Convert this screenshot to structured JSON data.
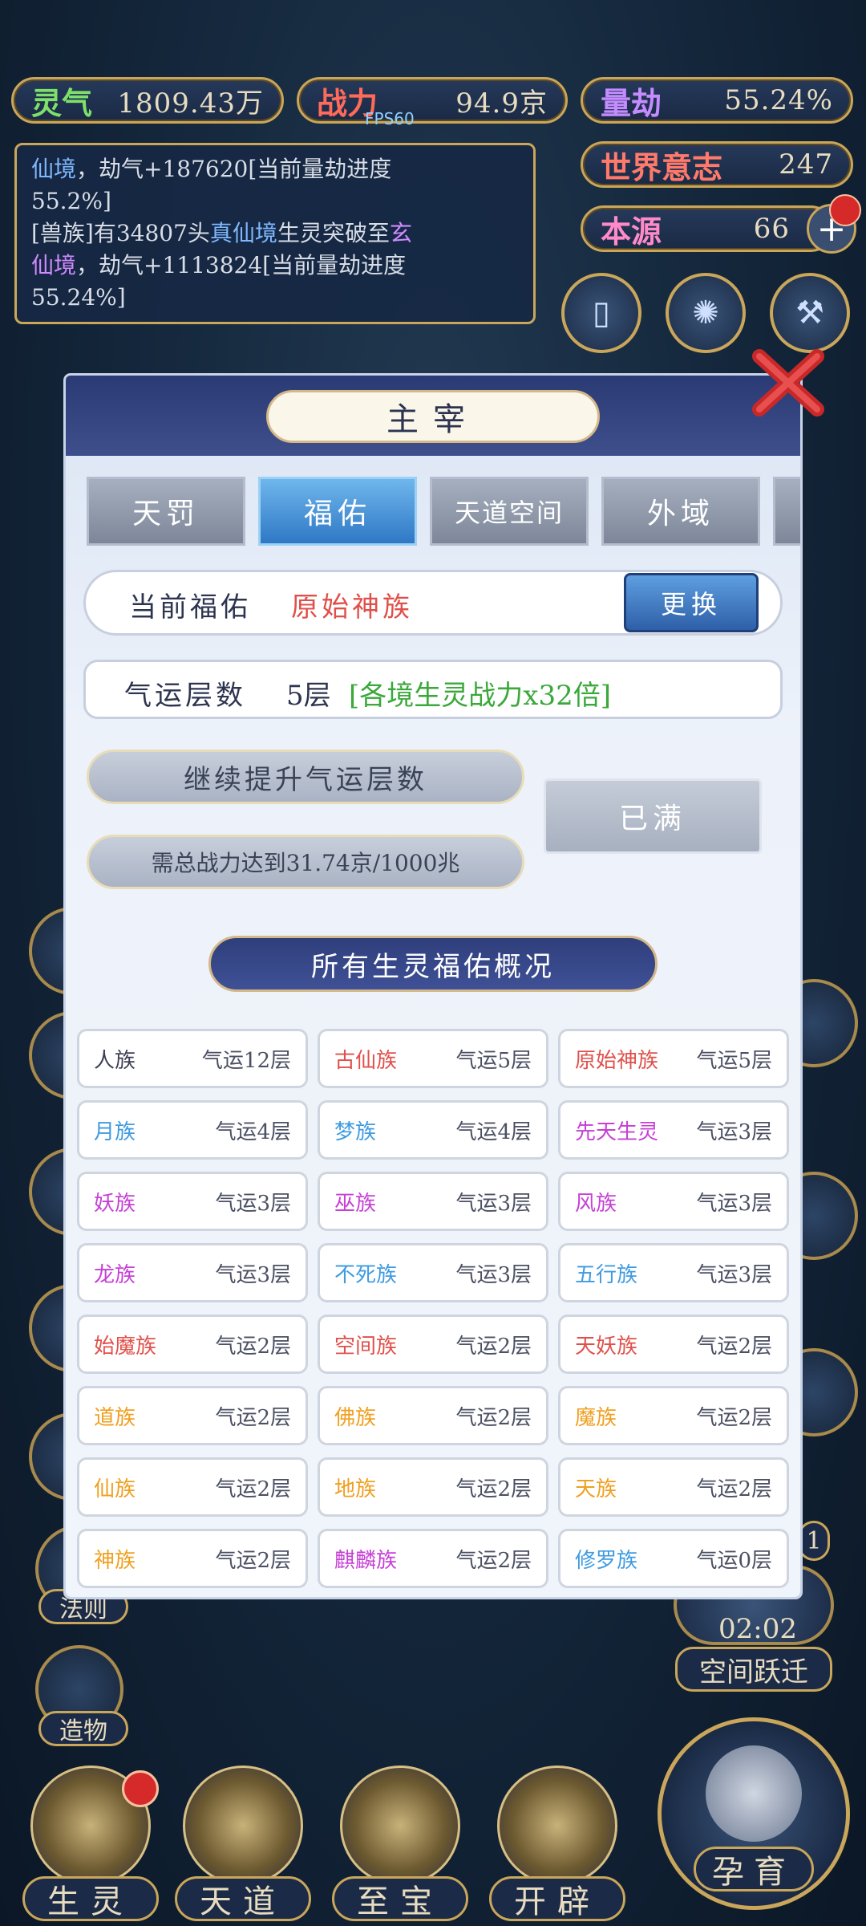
{
  "topbar": {
    "lingqi": {
      "label": "灵气",
      "value": "1809.43万"
    },
    "zhanli": {
      "label": "战力",
      "value": "94.9京"
    },
    "liangjie": {
      "label": "量劫",
      "value": "55.24%"
    },
    "world_will": {
      "label": "世界意志",
      "value": "247"
    },
    "benyuan": {
      "label": "本源",
      "value": "66"
    },
    "fps": "FPS60"
  },
  "log": {
    "line1a": "仙境",
    "line1b": "，劫气+187620[当前量劫进度",
    "line2": "55.2%]",
    "line3a": "[兽族]有34807头",
    "line3b": "真仙境",
    "line3c": "生灵突破至",
    "line3d": "玄",
    "line4a": "仙境",
    "line4b": "，劫气+1113824[当前量劫进度",
    "line5": "55.24%]"
  },
  "side_left": [
    {
      "label": "法则"
    },
    {
      "label": "造物"
    }
  ],
  "side_right": {
    "timer": "02:02",
    "label": "空间跃迁",
    "count": "1"
  },
  "bottom_nav": [
    {
      "label": "生灵"
    },
    {
      "label": "天道"
    },
    {
      "label": "至宝"
    },
    {
      "label": "开辟"
    },
    {
      "label": "孕育"
    }
  ],
  "modal": {
    "title": "主宰",
    "tabs": [
      "天罚",
      "福佑",
      "天道空间",
      "外域"
    ],
    "active_tab": "福佑",
    "current_label": "当前福佑",
    "current_value": "原始神族",
    "change_btn": "更换",
    "fortune_label": "气运层数",
    "fortune_value": "5层",
    "fortune_bonus": "[各境生灵战力x32倍]",
    "upgrade_title": "继续提升气运层数",
    "upgrade_req": "需总战力达到31.74京/1000兆",
    "full_btn": "已满",
    "overview_title": "所有生灵福佑概况",
    "races": [
      {
        "name": "人族",
        "level": "气运12层",
        "color": "#3b3f52"
      },
      {
        "name": "古仙族",
        "level": "气运5层",
        "color": "#e0504a"
      },
      {
        "name": "原始神族",
        "level": "气运5层",
        "color": "#e0504a"
      },
      {
        "name": "月族",
        "level": "气运4层",
        "color": "#3f9be0"
      },
      {
        "name": "梦族",
        "level": "气运4层",
        "color": "#3f9be0"
      },
      {
        "name": "先天生灵",
        "level": "气运3层",
        "color": "#c640d6"
      },
      {
        "name": "妖族",
        "level": "气运3层",
        "color": "#c640d6"
      },
      {
        "name": "巫族",
        "level": "气运3层",
        "color": "#c640d6"
      },
      {
        "name": "风族",
        "level": "气运3层",
        "color": "#c640d6"
      },
      {
        "name": "龙族",
        "level": "气运3层",
        "color": "#c640d6"
      },
      {
        "name": "不死族",
        "level": "气运3层",
        "color": "#3f9be0"
      },
      {
        "name": "五行族",
        "level": "气运3层",
        "color": "#3f9be0"
      },
      {
        "name": "始魔族",
        "level": "气运2层",
        "color": "#e0504a"
      },
      {
        "name": "空间族",
        "level": "气运2层",
        "color": "#e0504a"
      },
      {
        "name": "天妖族",
        "level": "气运2层",
        "color": "#e0504a"
      },
      {
        "name": "道族",
        "level": "气运2层",
        "color": "#f0a020"
      },
      {
        "name": "佛族",
        "level": "气运2层",
        "color": "#f0a020"
      },
      {
        "name": "魔族",
        "level": "气运2层",
        "color": "#f0a020"
      },
      {
        "name": "仙族",
        "level": "气运2层",
        "color": "#f0a020"
      },
      {
        "name": "地族",
        "level": "气运2层",
        "color": "#f0a020"
      },
      {
        "name": "天族",
        "level": "气运2层",
        "color": "#f0a020"
      },
      {
        "name": "神族",
        "level": "气运2层",
        "color": "#f0a020"
      },
      {
        "name": "麒麟族",
        "level": "气运2层",
        "color": "#c640d6"
      },
      {
        "name": "修罗族",
        "level": "气运0层",
        "color": "#3f9be0"
      }
    ]
  }
}
